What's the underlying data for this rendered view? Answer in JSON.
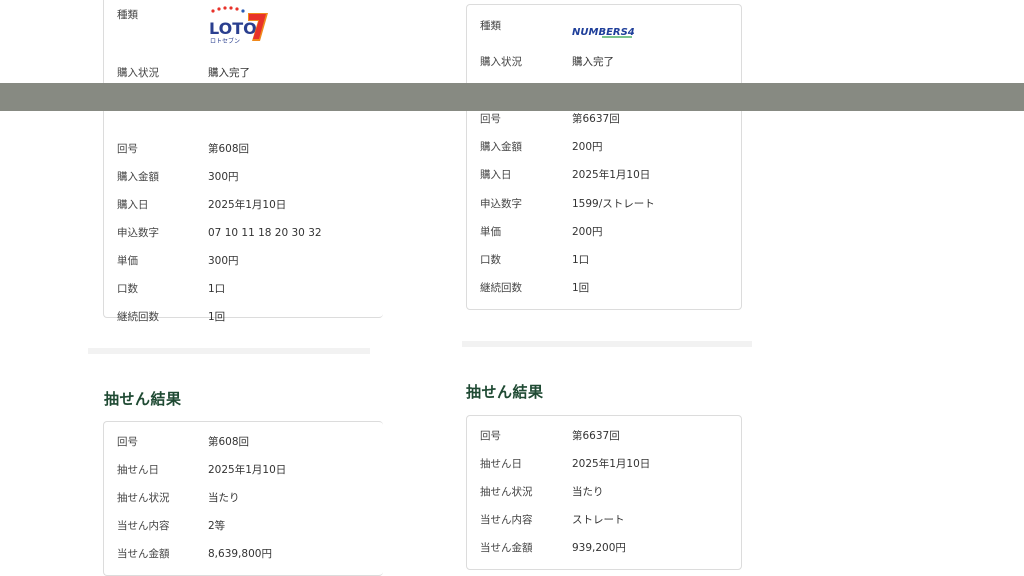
{
  "left_purchase": {
    "type_label": "種類",
    "logo_text": "LOTO7",
    "logo_sub": "ロトセブン",
    "rows": [
      {
        "label": "購入状況",
        "value": "購入完了"
      },
      {
        "label": "回号",
        "value": "第608回"
      },
      {
        "label": "購入金額",
        "value": "300円"
      },
      {
        "label": "購入日",
        "value": "2025年1月10日"
      },
      {
        "label": "申込数字",
        "value": "07 10 11 18 20 30 32"
      },
      {
        "label": "単価",
        "value": "300円"
      },
      {
        "label": "口数",
        "value": "1口"
      },
      {
        "label": "継続回数",
        "value": "1回"
      }
    ]
  },
  "right_purchase": {
    "type_label": "種類",
    "logo_text": "NUMBERS4",
    "rows": [
      {
        "label": "購入状況",
        "value": "購入完了"
      },
      {
        "label": "回号",
        "value": "第6637回"
      },
      {
        "label": "購入金額",
        "value": "200円"
      },
      {
        "label": "購入日",
        "value": "2025年1月10日"
      },
      {
        "label": "申込数字",
        "value": "1599/ストレート"
      },
      {
        "label": "単価",
        "value": "200円"
      },
      {
        "label": "口数",
        "value": "1口"
      },
      {
        "label": "継続回数",
        "value": "1回"
      }
    ]
  },
  "left_result": {
    "title": "抽せん結果",
    "rows": [
      {
        "label": "回号",
        "value": "第608回"
      },
      {
        "label": "抽せん日",
        "value": "2025年1月10日"
      },
      {
        "label": "抽せん状況",
        "value": "当たり"
      },
      {
        "label": "当せん内容",
        "value": "2等"
      },
      {
        "label": "当せん金額",
        "value": "8,639,800円"
      }
    ]
  },
  "right_result": {
    "title": "抽せん結果",
    "rows": [
      {
        "label": "回号",
        "value": "第6637回"
      },
      {
        "label": "抽せん日",
        "value": "2025年1月10日"
      },
      {
        "label": "抽せん状況",
        "value": "当たり"
      },
      {
        "label": "当せん内容",
        "value": "ストレート"
      },
      {
        "label": "当せん金額",
        "value": "939,200円"
      }
    ]
  },
  "colors": {
    "title_green": "#1f4a33",
    "overlay": "#878a82",
    "border": "#dcdcdc"
  }
}
